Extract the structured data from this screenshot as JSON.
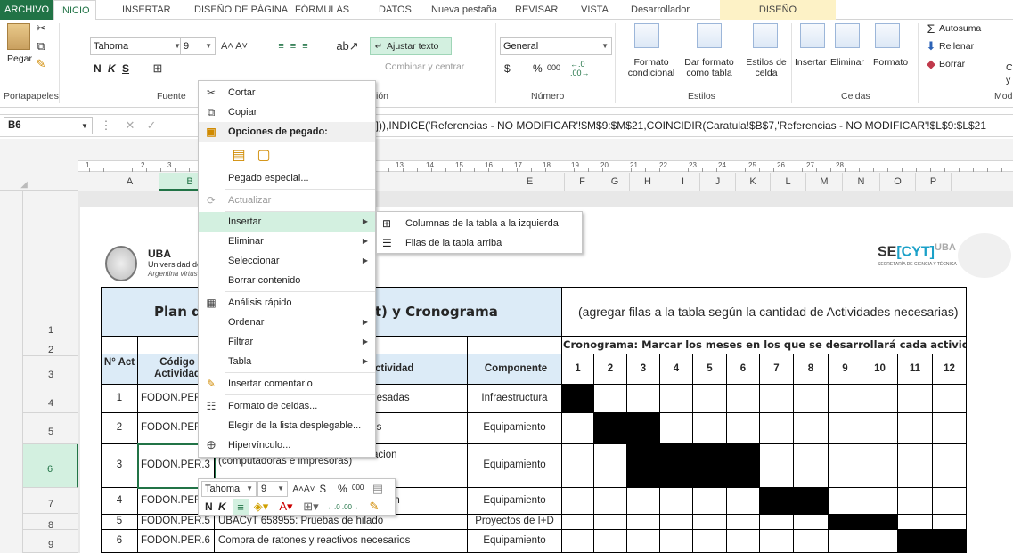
{
  "tabs": {
    "file": "ARCHIVO",
    "home": "INICIO",
    "insert": "INSERTAR",
    "layout": "DISEÑO DE PÁGINA",
    "formulas": "FÓRMULAS",
    "data": "DATOS",
    "newtab": "Nueva pestaña",
    "review": "REVISAR",
    "view": "VISTA",
    "dev": "Desarrollador",
    "design": "DISEÑO"
  },
  "ribbon": {
    "paste": "Pegar",
    "clipboard": "Portapapeles",
    "font_name": "Tahoma",
    "font_size": "9",
    "bold": "N",
    "italic": "K",
    "underline": "S",
    "font_group": "Fuente",
    "wrap": "Ajustar texto",
    "merge": "Combinar y centrar",
    "align_group": "ión",
    "number_format": "General",
    "currency": "$",
    "percent": "%",
    "thousands": "000",
    "number_group": "Número",
    "cond_format": "Formato condicional",
    "table_format": "Dar formato como tabla",
    "cell_styles": "Estilos de celda",
    "styles_group": "Estilos",
    "insert": "Insertar",
    "delete": "Eliminar",
    "format": "Formato",
    "cells_group": "Celdas",
    "autosum": "Autosuma",
    "fill": "Rellenar",
    "clear": "Borrar",
    "mod_group": "Mod",
    "trunc_c": "C",
    "trunc_y": "y"
  },
  "formula_bar": {
    "namebox": "B6",
    "formula": ":]])),INDICE('Referencias - NO MODIFICAR'!$M$9:$M$21,COINCIDIR(Caratula!$B$7,'Referencias - NO MODIFICAR'!$L$9:$L$21"
  },
  "ruler": [
    "1",
    "2",
    "3",
    "9",
    "10",
    "11",
    "12",
    "13",
    "14",
    "15",
    "16",
    "17",
    "18",
    "19",
    "20",
    "21",
    "22",
    "23",
    "24",
    "25",
    "26",
    "27",
    "28"
  ],
  "columns": [
    "A",
    "B",
    "D",
    "E",
    "F",
    "G",
    "H",
    "I",
    "J",
    "K",
    "L",
    "M",
    "N",
    "O",
    "P"
  ],
  "rows": [
    "1",
    "2",
    "3",
    "4",
    "5",
    "6",
    "7",
    "8",
    "9"
  ],
  "header": {
    "uba": "UBA",
    "uba_sub1": "Universidad de I",
    "uba_sub2": "Argentina virtus r",
    "secyt1": "SE",
    "secyt2": "[CYT]",
    "secyt3": "UBA",
    "secyt_sub": "SECRETARÍA DE CIENCIA Y TÉCNICA"
  },
  "table": {
    "title_left": "Plan d",
    "title_right": "ct) y Cronograma",
    "note": "(agregar filas a la tabla según la cantidad de Actividades necesarias)",
    "crono_title": "Cronograma: Marcar los meses en los que se desarrollará cada actividad",
    "col_n": "N° Act",
    "col_code": "Código Actividad",
    "col_act": "ctividad",
    "col_comp": "Componente",
    "months": [
      "1",
      "2",
      "3",
      "4",
      "5",
      "6",
      "7",
      "8",
      "9",
      "10",
      "11",
      "12"
    ],
    "rows": [
      {
        "n": "1",
        "code": "FODON.PER",
        "act": "mesadas",
        "comp": "Infraestructura"
      },
      {
        "n": "2",
        "code": "FODON.PER",
        "act": "tes",
        "comp": "Equipamiento"
      },
      {
        "n": "3",
        "code": "FODON.PER.3",
        "act": "(computadoras e impresoras)",
        "act_top": "acion",
        "comp": "Equipamiento"
      },
      {
        "n": "4",
        "code": "FODON.PER",
        "act": "icación",
        "comp": "Equipamiento"
      },
      {
        "n": "5",
        "code": "FODON.PER.5",
        "act": "UBACyT 658955: Pruebas de hilado",
        "comp": "Proyectos de I+D"
      },
      {
        "n": "6",
        "code": "FODON.PER.6",
        "act": "Compra de ratones y reactivos necesarios",
        "comp": "Equipamiento"
      }
    ]
  },
  "menu": {
    "cut": "Cortar",
    "copy": "Copiar",
    "paste_opts": "Opciones de pegado:",
    "paste_special": "Pegado especial...",
    "refresh": "Actualizar",
    "insert": "Insertar",
    "delete": "Eliminar",
    "select": "Seleccionar",
    "clear": "Borrar contenido",
    "quick": "Análisis rápido",
    "sort": "Ordenar",
    "filter": "Filtrar",
    "table": "Tabla",
    "comment": "Insertar comentario",
    "format_cells": "Formato de celdas...",
    "pick_list": "Elegir de la lista desplegable...",
    "hyperlink": "Hipervínculo..."
  },
  "submenu": {
    "cols_left": "Columnas de la tabla a la izquierda",
    "rows_above": "Filas de la tabla arriba"
  },
  "mini": {
    "font": "Tahoma",
    "size": "9",
    "currency": "$",
    "percent": "%",
    "thousands": "000",
    "bold": "N",
    "italic": "K"
  }
}
